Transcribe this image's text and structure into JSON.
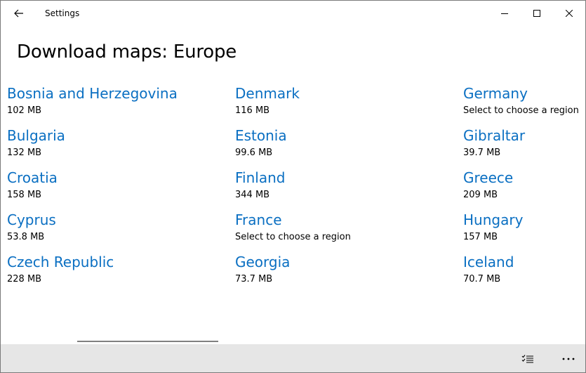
{
  "titlebar": {
    "app_title": "Settings",
    "icons": {
      "back": "back-arrow-icon",
      "minimize": "minimize-icon",
      "maximize": "maximize-icon",
      "close": "close-icon"
    }
  },
  "page": {
    "title": "Download maps: Europe"
  },
  "countries": [
    {
      "name": "Bosnia and Herzegovina",
      "detail": "102 MB"
    },
    {
      "name": "Bulgaria",
      "detail": "132 MB"
    },
    {
      "name": "Croatia",
      "detail": "158 MB"
    },
    {
      "name": "Cyprus",
      "detail": "53.8 MB"
    },
    {
      "name": "Czech Republic",
      "detail": "228 MB"
    },
    {
      "name": "Denmark",
      "detail": "116 MB"
    },
    {
      "name": "Estonia",
      "detail": "99.6 MB"
    },
    {
      "name": "Finland",
      "detail": "344 MB"
    },
    {
      "name": "France",
      "detail": "Select to choose a region"
    },
    {
      "name": "Georgia",
      "detail": "73.7 MB"
    },
    {
      "name": "Germany",
      "detail": "Select to choose a region"
    },
    {
      "name": "Gibraltar",
      "detail": "39.7 MB"
    },
    {
      "name": "Greece",
      "detail": "209 MB"
    },
    {
      "name": "Hungary",
      "detail": "157 MB"
    },
    {
      "name": "Iceland",
      "detail": "70.7 MB"
    }
  ],
  "commandbar": {
    "icons": {
      "select": "select-list-icon",
      "more": "more-options-icon"
    }
  },
  "colors": {
    "accent": "#0a6fc2",
    "commandbar_bg": "#e6e6e6",
    "text": "#000000"
  }
}
